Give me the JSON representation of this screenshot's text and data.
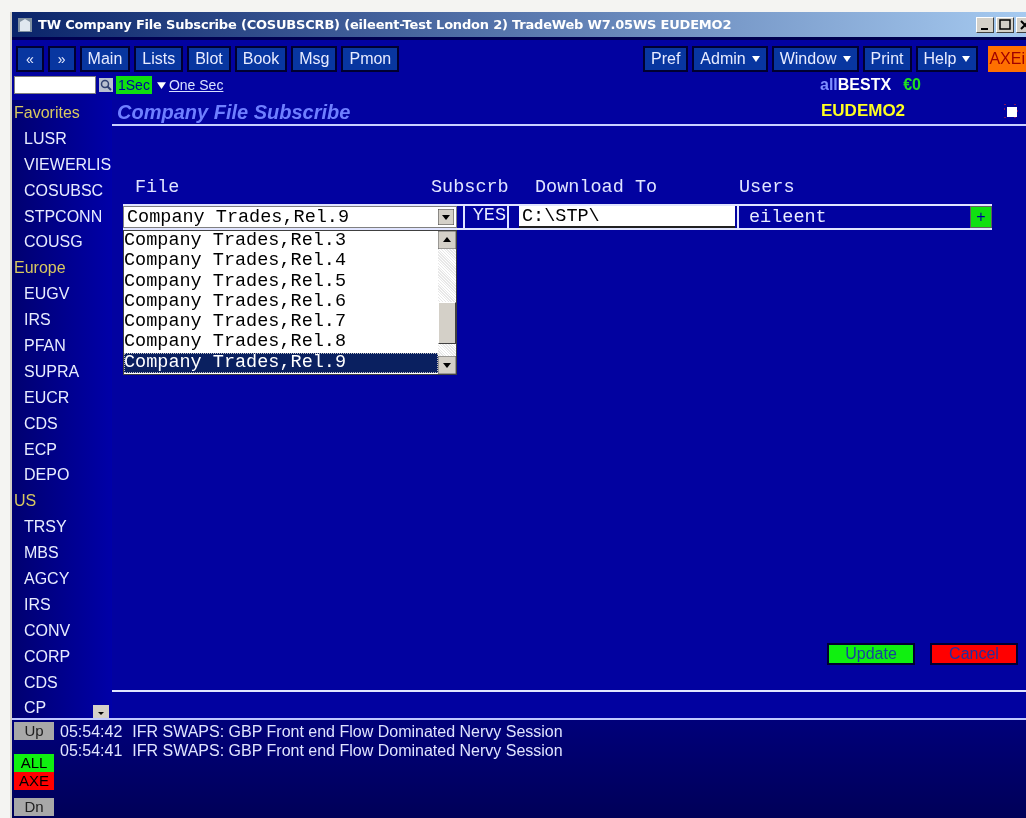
{
  "window": {
    "title": "TW Company File Subscribe (COSUBSCRB) (eileent-Test London 2) TradeWeb W7.05WS EUDEMO2"
  },
  "toolbar_left": [
    {
      "label": "«",
      "kind": "nav"
    },
    {
      "label": "»",
      "kind": "nav"
    },
    {
      "label": "Main",
      "kind": "menu",
      "dropdown": false
    },
    {
      "label": "Lists",
      "kind": "menu",
      "dropdown": false
    },
    {
      "label": "Blot",
      "kind": "menu",
      "dropdown": false
    },
    {
      "label": "Book",
      "kind": "menu",
      "dropdown": false
    },
    {
      "label": "Msg",
      "kind": "menu",
      "dropdown": false
    },
    {
      "label": "Pmon",
      "kind": "menu",
      "dropdown": false
    }
  ],
  "toolbar_right": [
    {
      "label": "Pref",
      "kind": "menu",
      "dropdown": false
    },
    {
      "label": "Admin",
      "kind": "menu",
      "dropdown": true
    },
    {
      "label": "Window",
      "kind": "menu",
      "dropdown": true
    },
    {
      "label": "Print",
      "kind": "menu",
      "dropdown": false
    },
    {
      "label": "Help",
      "kind": "menu",
      "dropdown": true
    },
    {
      "label": "AXEi",
      "kind": "brand"
    }
  ],
  "refresh": {
    "badge": "1Sec",
    "link": "One Sec"
  },
  "account": {
    "prefix": "all",
    "name": "BESTX",
    "balance": "€0",
    "code": "EUDEMO2"
  },
  "sidebar": {
    "groups": [
      {
        "heading": "Favorites",
        "items": [
          "LUSR",
          "VIEWERLIS",
          "COSUBSC",
          "STPCONN",
          "COUSG"
        ]
      },
      {
        "heading": "Europe",
        "items": [
          "EUGV",
          "IRS",
          "PFAN",
          "SUPRA",
          "EUCR",
          "CDS",
          "ECP",
          "DEPO"
        ]
      },
      {
        "heading": "US",
        "items": [
          "TRSY",
          "MBS",
          "AGCY",
          "IRS",
          "CONV",
          "CORP",
          "CDS",
          "CP"
        ]
      }
    ]
  },
  "page_title": "Company File Subscribe",
  "form": {
    "columns": [
      "File",
      "Subscrb",
      "Download To",
      "Users"
    ],
    "row": {
      "file": "Company Trades,Rel.9",
      "subscribe": "YES",
      "download_to": "C:\\STP\\",
      "users": "eileent"
    },
    "options": [
      {
        "label": "Company Trades,Rel.3",
        "selected": false
      },
      {
        "label": "Company Trades,Rel.4",
        "selected": false
      },
      {
        "label": "Company Trades,Rel.5",
        "selected": false
      },
      {
        "label": "Company Trades,Rel.6",
        "selected": false
      },
      {
        "label": "Company Trades,Rel.7",
        "selected": false
      },
      {
        "label": "Company Trades,Rel.8",
        "selected": false
      },
      {
        "label": "Company Trades,Rel.9",
        "selected": true
      }
    ],
    "add_label": "+"
  },
  "actions": [
    {
      "label": "Update",
      "kind": "confirm"
    },
    {
      "label": "Cancel",
      "kind": "cancel"
    }
  ],
  "messages": [
    {
      "time": "05:54:42",
      "text": "IFR SWAPS: GBP Front end Flow Dominated Nervy Session"
    },
    {
      "time": "05:54:41",
      "text": "IFR SWAPS: GBP Front end Flow Dominated Nervy Session"
    }
  ],
  "message_controls": [
    {
      "label": "Up",
      "kind": "scroll"
    },
    {
      "label": "ALL",
      "kind": "filter-all"
    },
    {
      "label": "AXE",
      "kind": "filter-axe"
    },
    {
      "label": "Dn",
      "kind": "scroll"
    }
  ]
}
